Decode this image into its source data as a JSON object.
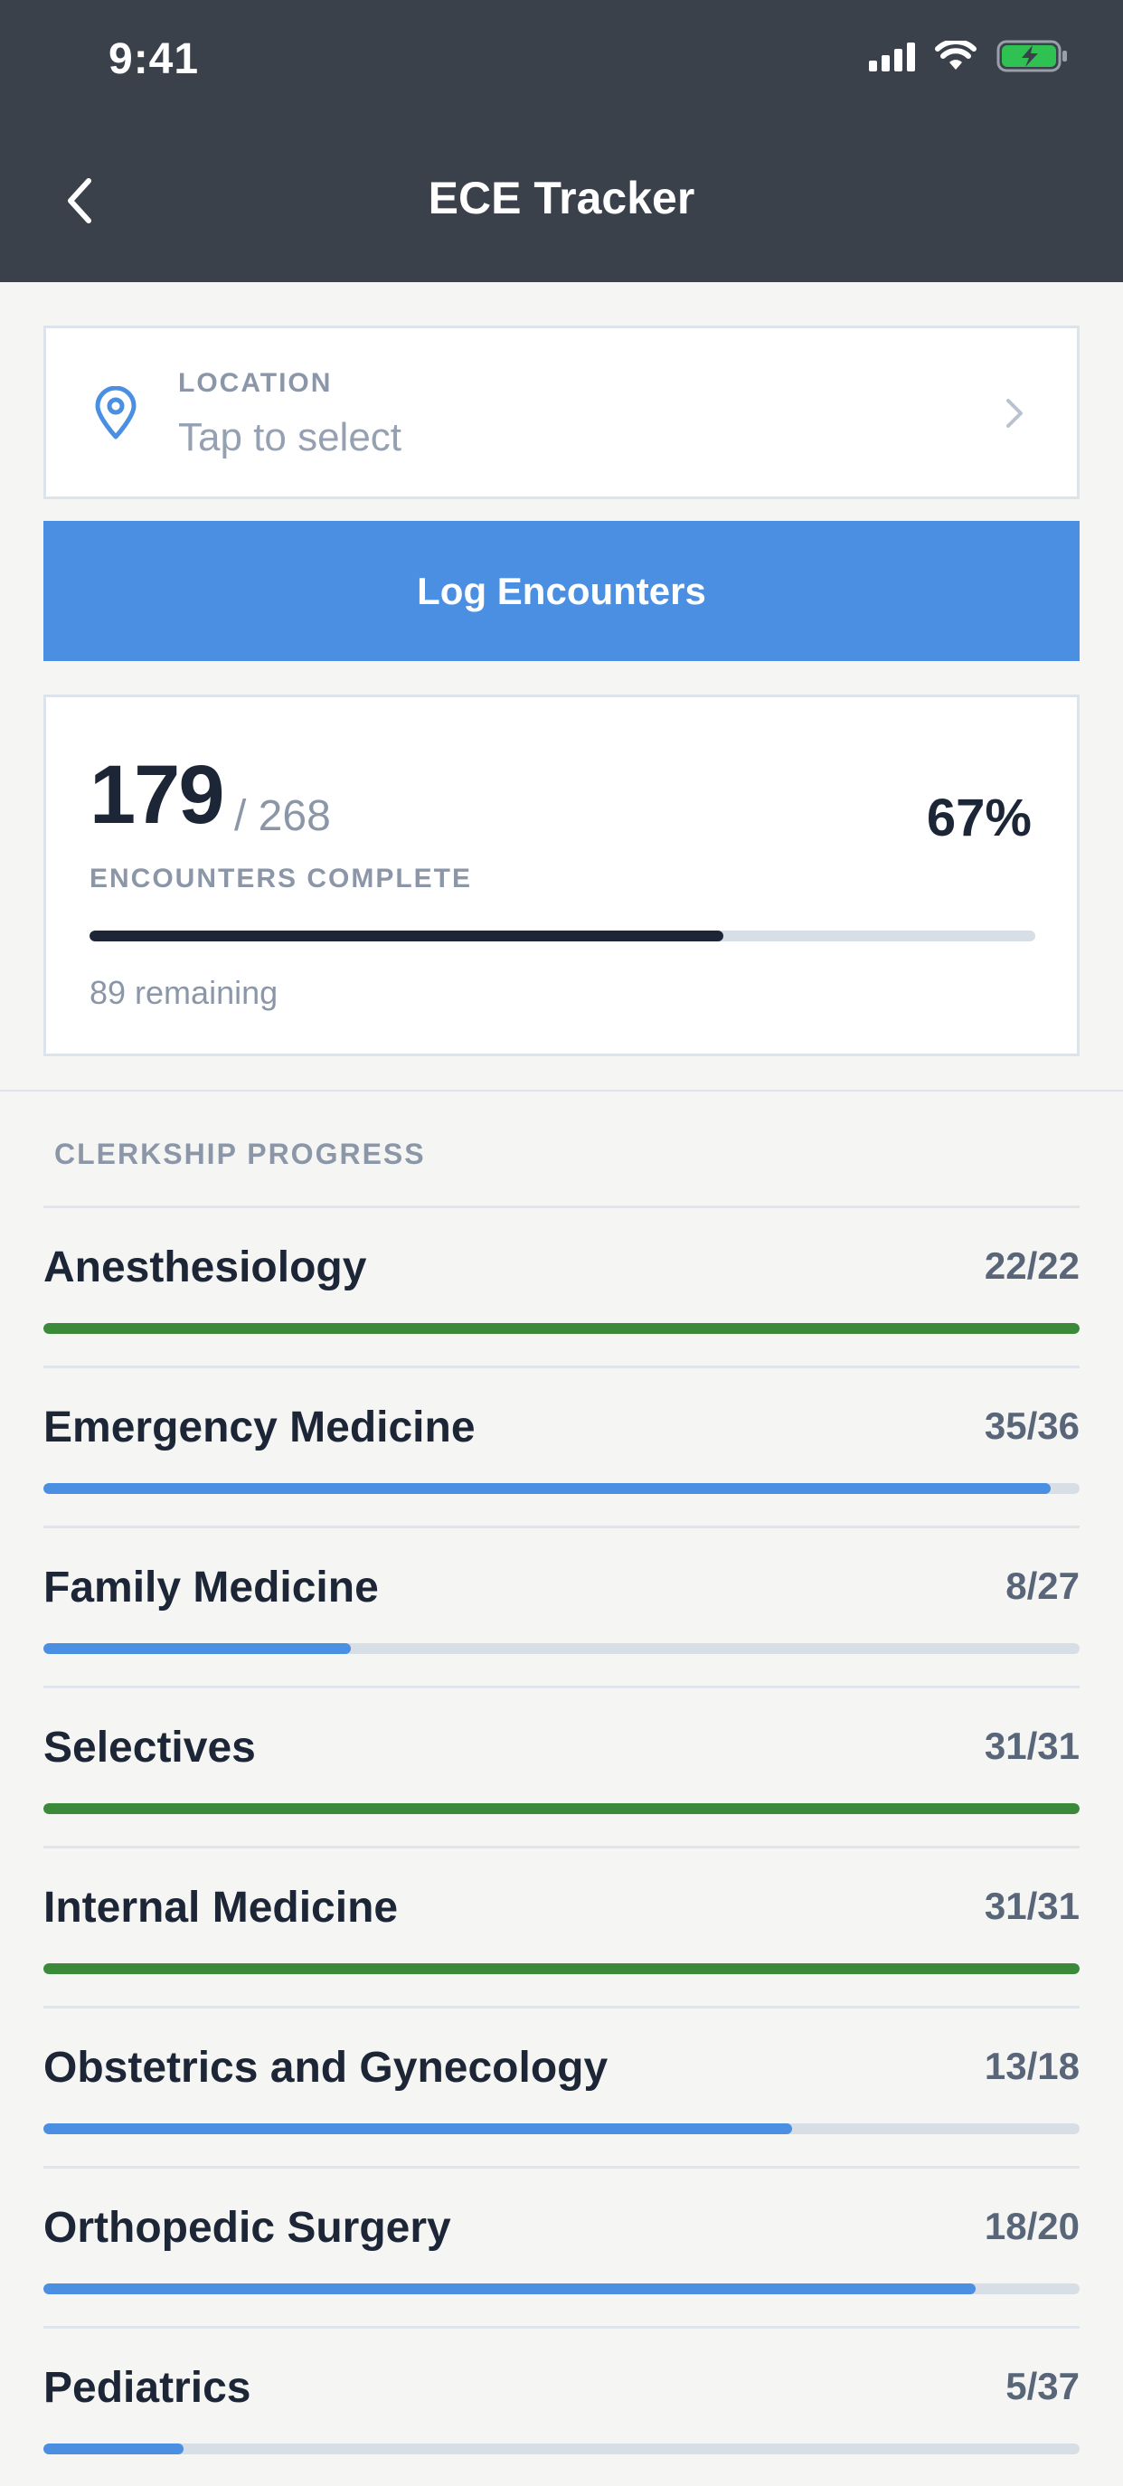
{
  "status_bar": {
    "time": "9:41",
    "battery_color": "#2fc152"
  },
  "nav": {
    "title": "ECE Tracker"
  },
  "location": {
    "label": "LOCATION",
    "value": "Tap to select"
  },
  "log_button": {
    "label": "Log Encounters"
  },
  "summary": {
    "count": "179",
    "total": "/ 268",
    "percent": "67%",
    "progress": 0.67,
    "label": "ENCOUNTERS COMPLETE",
    "remaining": "89 remaining"
  },
  "section": {
    "heading": "CLERKSHIP PROGRESS"
  },
  "colors": {
    "complete": "#3a8a3a",
    "in_progress": "#4a8fe1",
    "track": "#d8dee6"
  },
  "clerkships": [
    {
      "name": "Anesthesiology",
      "count": "22/22",
      "done": 22,
      "total": 22
    },
    {
      "name": "Emergency Medicine",
      "count": "35/36",
      "done": 35,
      "total": 36
    },
    {
      "name": "Family Medicine",
      "count": "8/27",
      "done": 8,
      "total": 27
    },
    {
      "name": "Selectives",
      "count": "31/31",
      "done": 31,
      "total": 31
    },
    {
      "name": "Internal Medicine",
      "count": "31/31",
      "done": 31,
      "total": 31
    },
    {
      "name": "Obstetrics and Gynecology",
      "count": "13/18",
      "done": 13,
      "total": 18
    },
    {
      "name": "Orthopedic Surgery",
      "count": "18/20",
      "done": 18,
      "total": 20
    },
    {
      "name": "Pediatrics",
      "count": "5/37",
      "done": 5,
      "total": 37
    }
  ]
}
